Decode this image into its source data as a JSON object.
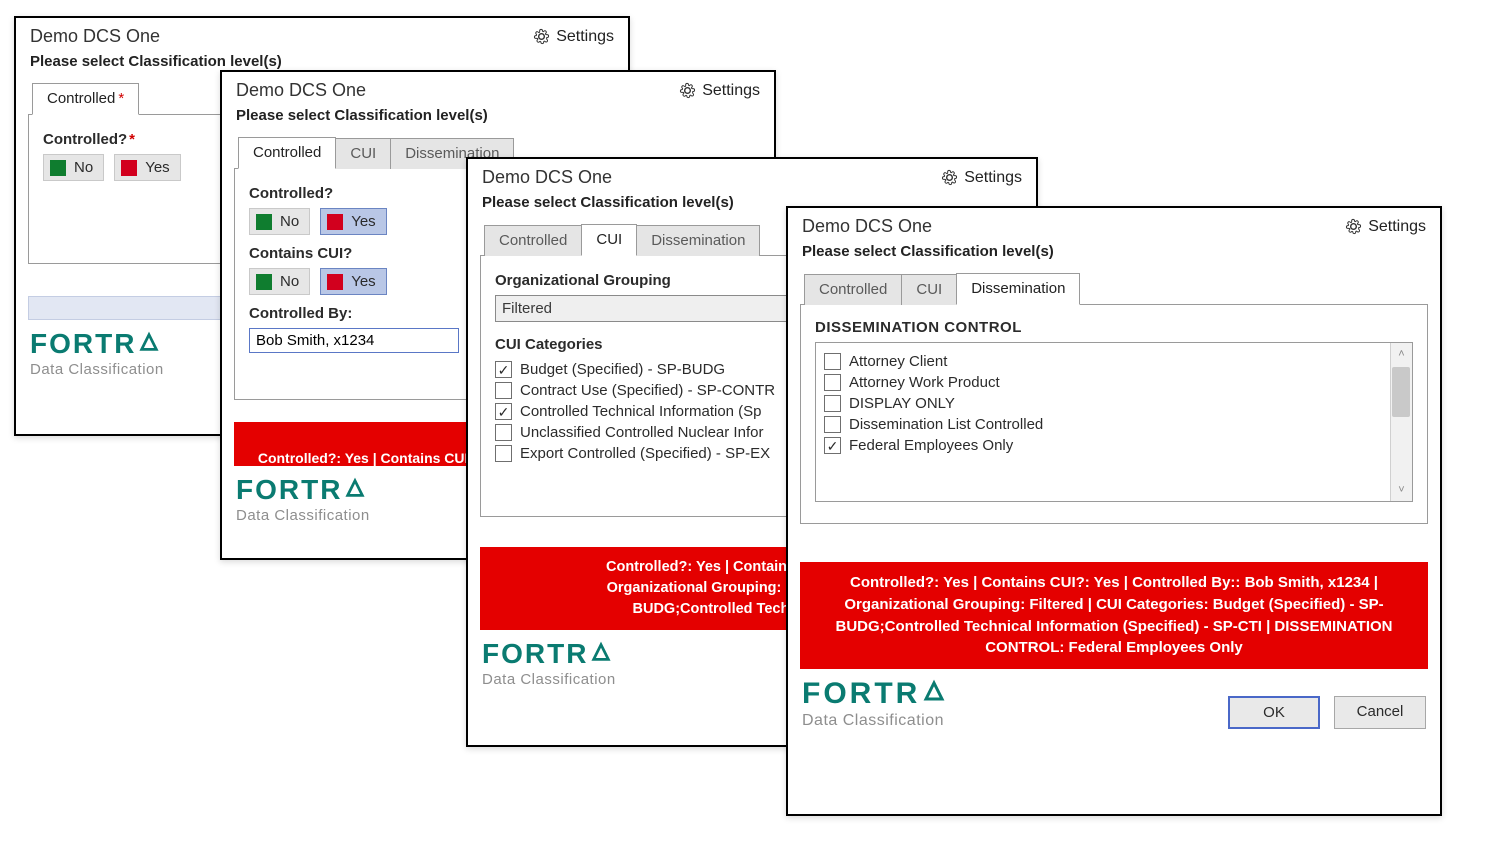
{
  "common": {
    "app_title": "Demo DCS One",
    "settings_label": "Settings",
    "prompt": "Please select Classification level(s)",
    "logo_word": "FORTR",
    "logo_sub": "Data Classification",
    "ok_label": "OK",
    "cancel_label": "Cancel"
  },
  "tabs": {
    "controlled": "Controlled",
    "cui": "CUI",
    "dissemination": "Dissemination"
  },
  "yn": {
    "no": "No",
    "yes": "Yes"
  },
  "dlg1": {
    "controlled_q": "Controlled?"
  },
  "dlg2": {
    "controlled_q": "Controlled?",
    "contains_cui_q": "Contains CUI?",
    "controlled_by_label": "Controlled By:",
    "controlled_by_value": "Bob Smith, x1234",
    "summary": "Controlled?: Yes | Contains CUI?: Yes | Controlled By: Bob Smith, x1234\nOrganizational Grouping: ..."
  },
  "dlg3": {
    "org_group_label": "Organizational Grouping",
    "org_group_value": "Filtered",
    "cui_cat_label": "CUI Categories",
    "cui_cats": [
      {
        "label": "Budget (Specified) - SP-BUDG",
        "checked": true
      },
      {
        "label": "Contract Use (Specified) - SP-CONTR",
        "checked": false
      },
      {
        "label": "Controlled Technical Information (Sp",
        "checked": true
      },
      {
        "label": "Unclassified Controlled Nuclear Infor",
        "checked": false
      },
      {
        "label": "Export Controlled (Specified) - SP-EX",
        "checked": false
      }
    ],
    "summary_lines": [
      "Controlled?: Yes | Contains CUI?: Yes | Co",
      "Organizational Grouping: Filtered | CUI Ca",
      "BUDG;Controlled Technical Inform"
    ]
  },
  "dlg4": {
    "diss_title": "DISSEMINATION CONTROL",
    "diss_items": [
      {
        "label": "Attorney Client",
        "checked": false
      },
      {
        "label": "Attorney Work Product",
        "checked": false
      },
      {
        "label": "DISPLAY ONLY",
        "checked": false
      },
      {
        "label": "Dissemination List Controlled",
        "checked": false
      },
      {
        "label": "Federal Employees Only",
        "checked": true
      }
    ],
    "summary_lines": [
      "Controlled?: Yes | Contains CUI?: Yes | Controlled By:: Bob Smith, x1234 |",
      "Organizational Grouping: Filtered | CUI Categories: Budget (Specified) - SP-",
      "BUDG;Controlled Technical Information (Specified) - SP-CTI | DISSEMINATION",
      "CONTROL: Federal Employees Only"
    ]
  }
}
